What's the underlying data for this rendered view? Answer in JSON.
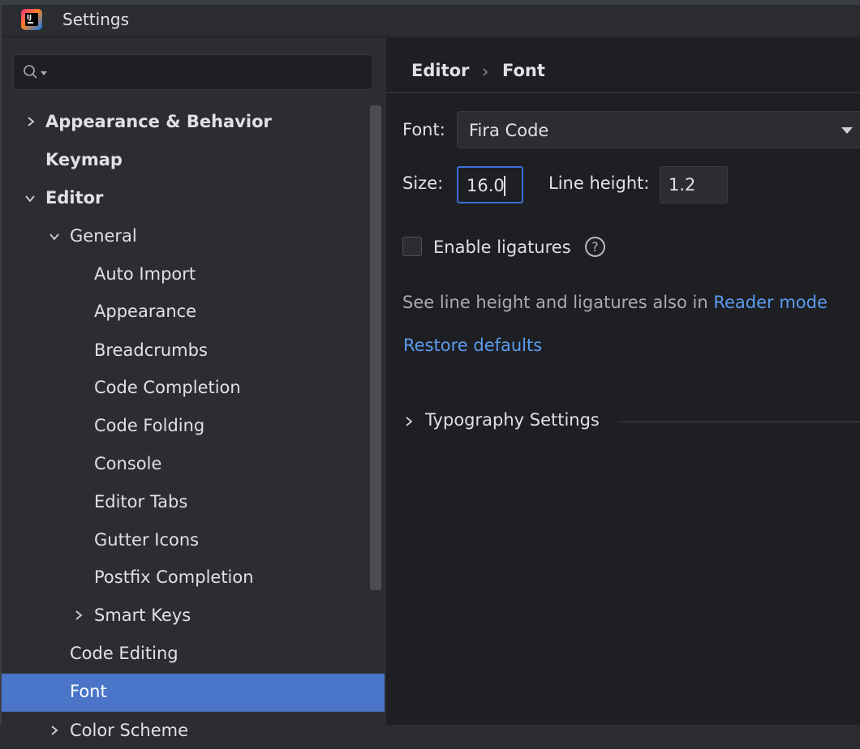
{
  "titlebar": {
    "app_logo_text": "IJ",
    "title": "Settings"
  },
  "sidebar": {
    "search": {
      "value": "",
      "placeholder": ""
    },
    "items": [
      {
        "label": "Appearance & Behavior",
        "expanded": false,
        "bold": true
      },
      {
        "label": "Keymap",
        "bold": true
      },
      {
        "label": "Editor",
        "expanded": true,
        "bold": true
      },
      {
        "label": "General",
        "expanded": true
      },
      {
        "label": "Auto Import"
      },
      {
        "label": "Appearance"
      },
      {
        "label": "Breadcrumbs"
      },
      {
        "label": "Code Completion"
      },
      {
        "label": "Code Folding"
      },
      {
        "label": "Console"
      },
      {
        "label": "Editor Tabs"
      },
      {
        "label": "Gutter Icons"
      },
      {
        "label": "Postfix Completion"
      },
      {
        "label": "Smart Keys",
        "expanded": false
      },
      {
        "label": "Code Editing"
      },
      {
        "label": "Font",
        "selected": true
      },
      {
        "label": "Color Scheme",
        "expanded": false,
        "bold": true
      }
    ]
  },
  "main": {
    "breadcrumb": {
      "parent": "Editor",
      "current": "Font"
    },
    "font": {
      "label": "Font:",
      "value": "Fira Code"
    },
    "size": {
      "label": "Size:",
      "value": "16.0"
    },
    "line_height": {
      "label": "Line height:",
      "value": "1.2"
    },
    "ligatures": {
      "label": "Enable ligatures",
      "checked": false
    },
    "reader_note": {
      "text": "See line height and ligatures also in ",
      "link": "Reader mode"
    },
    "restore_defaults": "Restore defaults",
    "typography_settings": {
      "label": "Typography Settings",
      "expanded": false
    }
  },
  "colors": {
    "selection": "#4a75c8",
    "link": "#5b9bf0",
    "focus_border": "#3d6ed8"
  }
}
